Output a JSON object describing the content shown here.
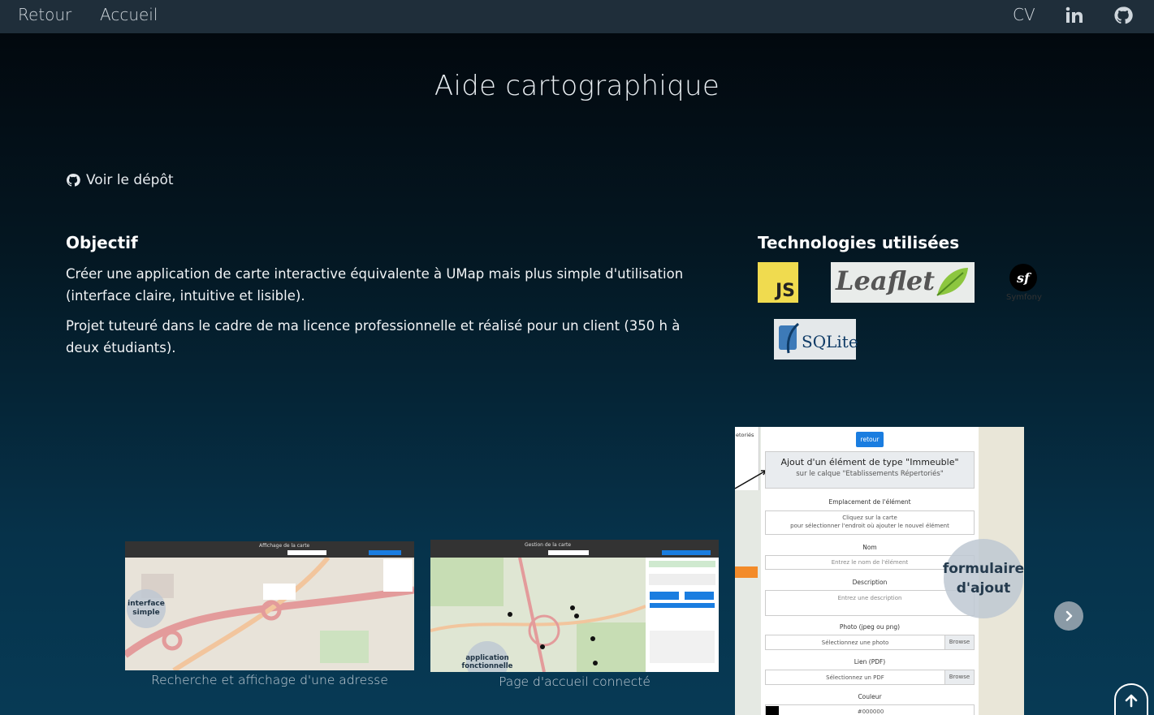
{
  "nav": {
    "back": "Retour",
    "home": "Accueil",
    "cv": "CV",
    "linkedin_icon": "linkedin-icon",
    "github_icon": "github-icon"
  },
  "page": {
    "title": "Aide cartographique"
  },
  "repo": {
    "label": "Voir le dépôt",
    "icon": "github-icon"
  },
  "objective": {
    "heading": "Objectif",
    "p1": "Créer une application de carte interactive équivalente à UMap mais plus simple d'utilisation (interface claire, intuitive et lisible).",
    "p2": "Projet tuteuré dans le cadre de ma licence professionnelle et réalisé pour un client (350 h à deux étudiants)."
  },
  "tech": {
    "heading": "Technologies utilisées",
    "js": "JS",
    "leaflet": "Leaflet",
    "symfony_logo": "sf",
    "symfony": "Symfony",
    "sqlite": "SQLite"
  },
  "carousel": {
    "items": [
      {
        "caption": "Recherche et affichage d'une adresse",
        "bubble": "interface simple",
        "topbar": "Affichage de la carte"
      },
      {
        "caption": "Page d'accueil connecté",
        "bubble": "application fonctionnelle",
        "topbar": "Gestion de la carte"
      }
    ],
    "featured": {
      "bubble": "formulaire d'ajout",
      "back_button": "retour",
      "side_label": "etoriés",
      "title": "Ajout d'un élément de type \"Immeuble\"",
      "subtitle": "sur le calque \"Etablissements Répertoriés\"",
      "loc_label": "Emplacement de l'élément",
      "loc_hint_1": "Cliquez sur la carte",
      "loc_hint_2": "pour sélectionner l'endroit où ajouter le nouvel élément",
      "name_label": "Nom",
      "name_placeholder": "Entrez le nom de l'élément",
      "desc_label": "Description",
      "desc_placeholder": "Entrez une description",
      "photo_label": "Photo (jpeg ou png)",
      "photo_placeholder": "Sélectionnez une photo",
      "browse": "Browse",
      "pdf_label": "Lien (PDF)",
      "pdf_placeholder": "Sélectionnez un PDF",
      "color_label": "Couleur",
      "color_value": "#000000"
    },
    "next_icon": "chevron-right-icon"
  },
  "scroll_top_icon": "arrow-up-icon",
  "colors": {
    "nav_bg": "#1f2e3a",
    "accent_blue": "#1a7de0",
    "js_yellow": "#f0db4f"
  }
}
